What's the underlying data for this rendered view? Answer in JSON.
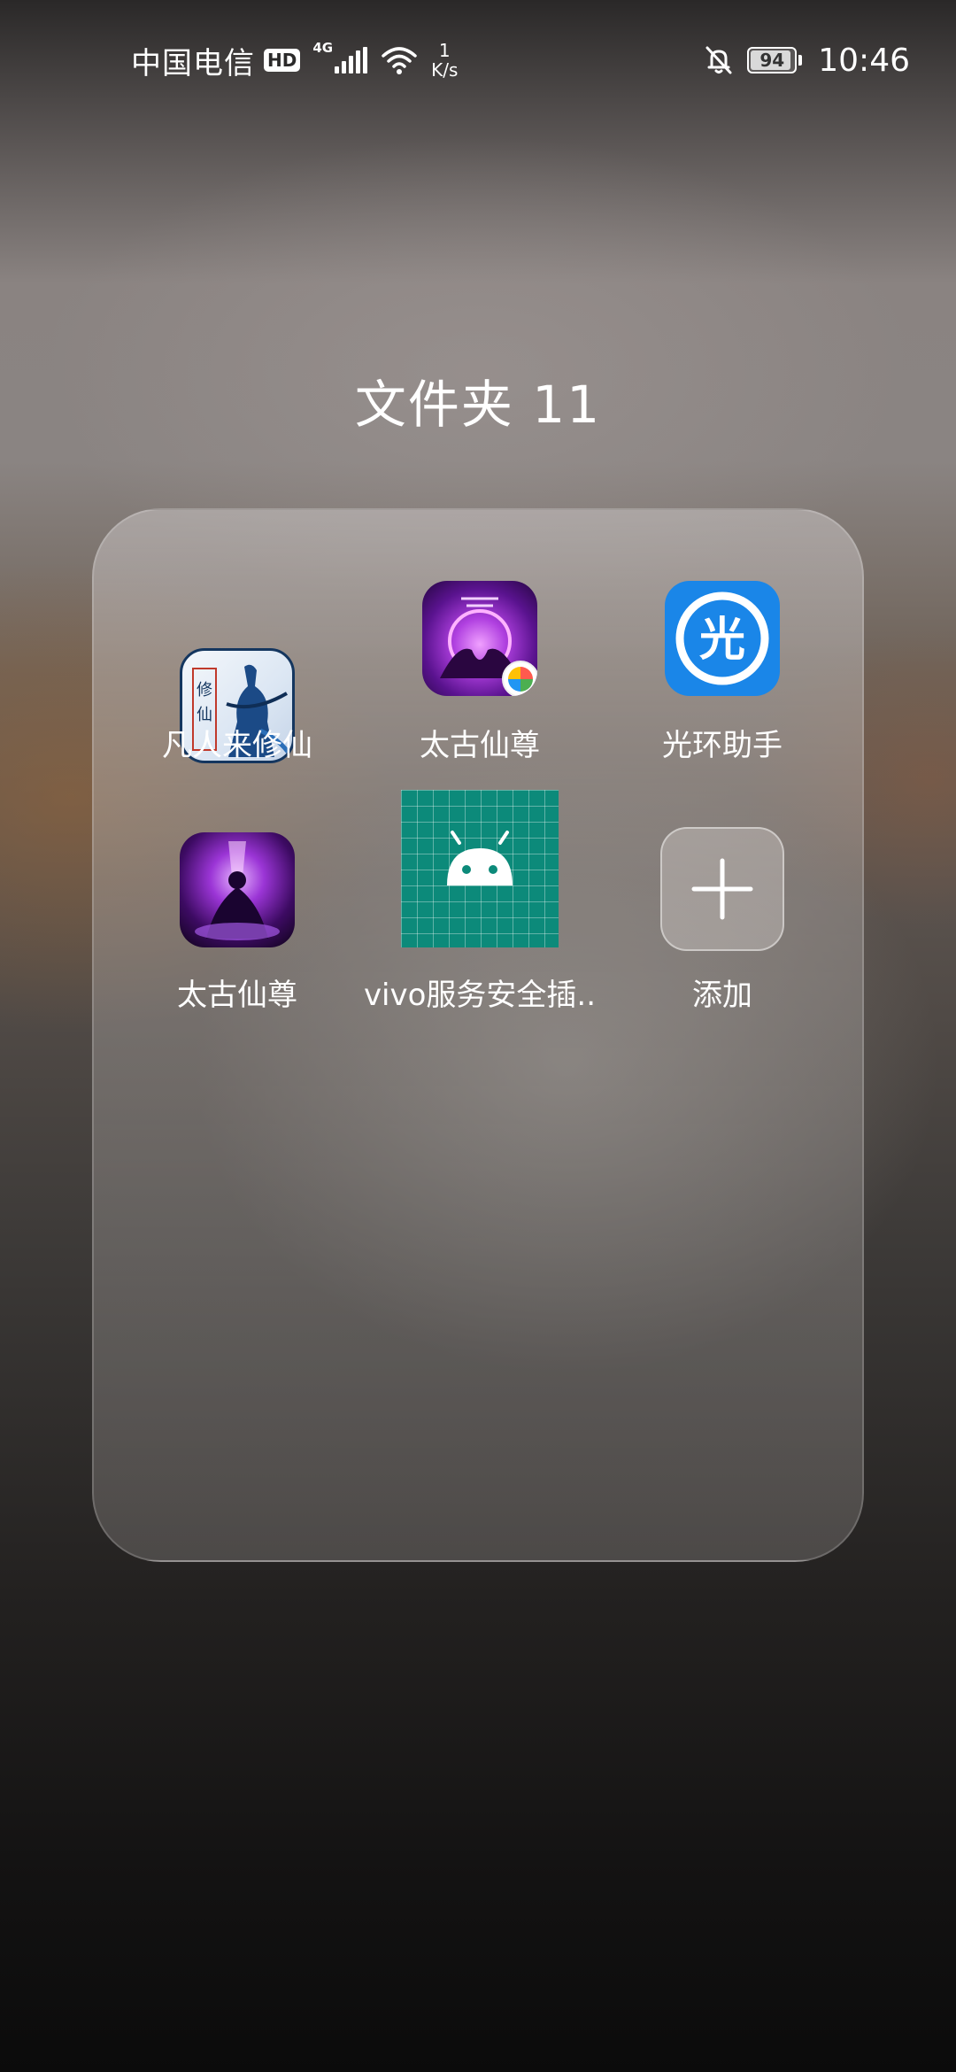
{
  "status_bar": {
    "carrier": "中国电信",
    "hd": "HD",
    "network_type": "4G",
    "speed_value": "1",
    "speed_unit": "K/s",
    "battery": "94",
    "battery_fraction": 0.94,
    "time": "10:46",
    "icons": [
      "signal-icon",
      "wifi-icon",
      "bell-muted-icon",
      "battery-icon"
    ]
  },
  "folder": {
    "title": "文件夹 11",
    "apps": [
      {
        "label": "凡人来修仙",
        "icon": "fanren-xiuxian-icon"
      },
      {
        "label": "太古仙尊",
        "icon": "taigu-xianzun-icon"
      },
      {
        "label": "光环助手",
        "icon": "guanghuan-assistant-icon",
        "glyph": "光"
      },
      {
        "label": "太古仙尊",
        "icon": "taigu-xianzun-icon"
      },
      {
        "label": "vivo服务安全插..",
        "icon": "android-icon"
      },
      {
        "label": "添加",
        "icon": "plus-icon"
      }
    ]
  },
  "colors": {
    "guanghuan_blue": "#1a86e8",
    "vivo_teal": "#0c8a7a",
    "taigu_purple": "#9b35d6"
  }
}
